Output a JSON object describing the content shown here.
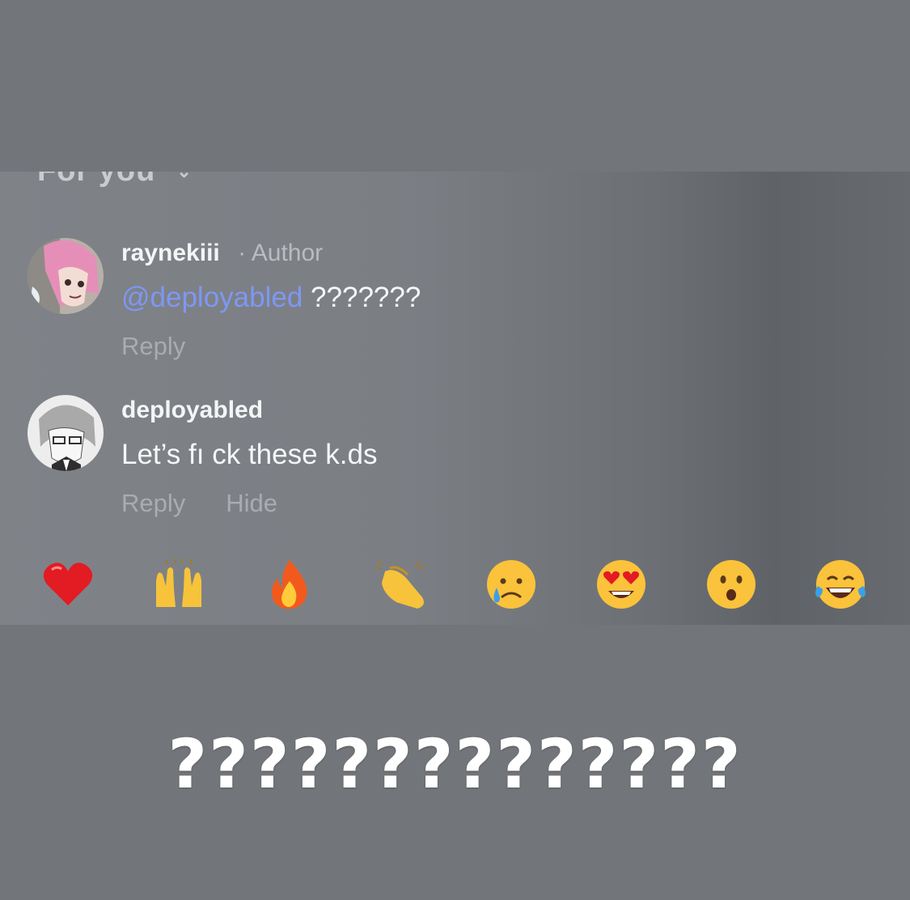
{
  "sort": {
    "label": "For you"
  },
  "comments": [
    {
      "username": "raynekiii",
      "badge": "· Author",
      "mention": "@deployabled",
      "text": "???????",
      "actions": [
        "Reply"
      ]
    },
    {
      "username": "deployabled",
      "badge": "",
      "mention": "",
      "text": "Let’s fı ck these k.ds",
      "actions": [
        "Reply",
        "Hide"
      ]
    }
  ],
  "reactions": [
    "red-heart",
    "raised-hands",
    "fire",
    "clapping-hands",
    "crying-face",
    "heart-eyes",
    "surprised-face",
    "tears-of-joy"
  ],
  "caption": "??????????????",
  "colors": {
    "mention": "#7e97f4",
    "background": "#727579"
  }
}
